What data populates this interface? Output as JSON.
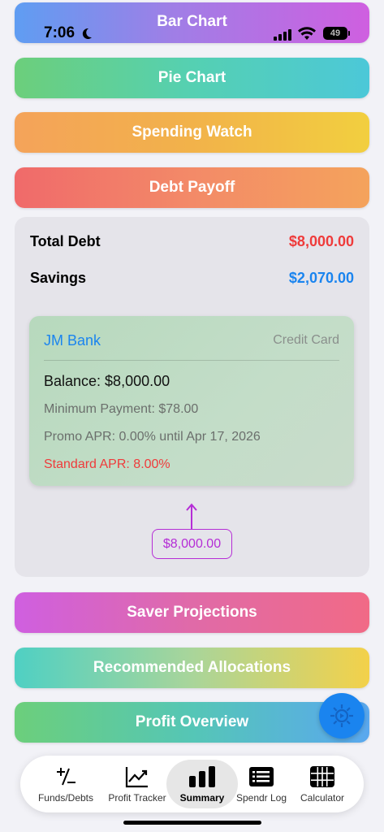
{
  "status_bar": {
    "time": "7:06",
    "battery": "49"
  },
  "buttons": {
    "bar_chart": "Bar Chart",
    "pie_chart": "Pie Chart",
    "spending_watch": "Spending Watch",
    "debt_payoff": "Debt Payoff",
    "saver_projections": "Saver Projections",
    "recommended_allocations": "Recommended Allocations",
    "profit_overview": "Profit Overview"
  },
  "summary": {
    "total_debt_label": "Total Debt",
    "total_debt_value": "$8,000.00",
    "savings_label": "Savings",
    "savings_value": "$2,070.00"
  },
  "card": {
    "bank": "JM Bank",
    "type": "Credit Card",
    "balance": "Balance: $8,000.00",
    "minimum_payment": "Minimum Payment: $78.00",
    "promo_apr": "Promo APR: 0.00% until Apr 17, 2026",
    "standard_apr": "Standard APR: 8.00%"
  },
  "annotation": {
    "amount": "$8,000.00"
  },
  "colors": {
    "debt": "#ef3b3b",
    "savings": "#1a84ef",
    "annotation": "#b52dd6"
  },
  "tabs": [
    {
      "label": "Funds/Debts",
      "icon": "plus-minus-icon",
      "active": false
    },
    {
      "label": "Profit Tracker",
      "icon": "trend-chart-icon",
      "active": false
    },
    {
      "label": "Summary",
      "icon": "bar-chart-icon",
      "active": true
    },
    {
      "label": "Spendr Log",
      "icon": "list-icon",
      "active": false
    },
    {
      "label": "Calculator",
      "icon": "grid-icon",
      "active": false
    }
  ]
}
